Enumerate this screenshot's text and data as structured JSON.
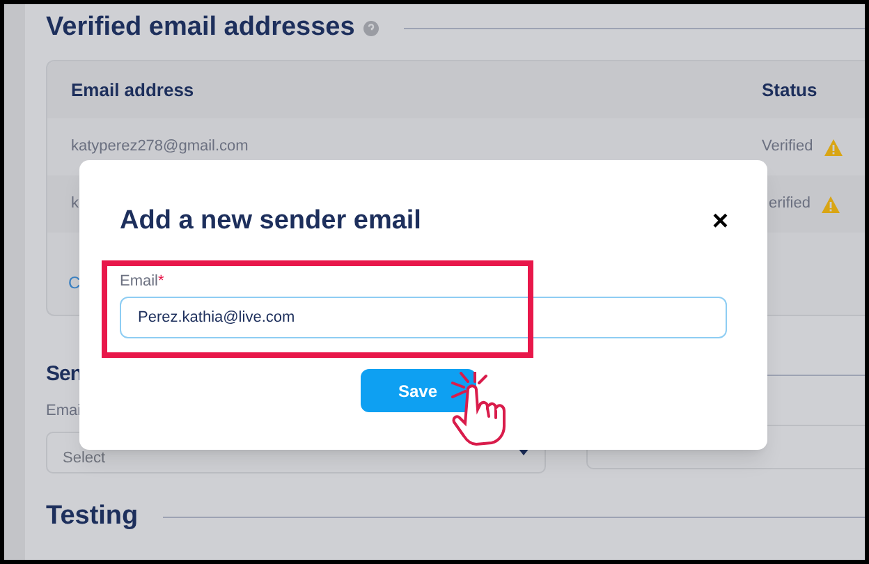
{
  "page": {
    "title": "Verified email addresses",
    "table": {
      "columns": [
        "Email address",
        "Status"
      ],
      "rows": [
        {
          "email": "katyperez278@gmail.com",
          "status": "Verified"
        },
        {
          "email": "k",
          "status": "erified"
        }
      ]
    },
    "link": "C",
    "sender_section": {
      "title": "Sen",
      "field_label": "Emai",
      "select_placeholder": "Select"
    },
    "testing_section": {
      "title": "Testing"
    }
  },
  "modal": {
    "title": "Add a new sender email",
    "close": "×",
    "field": {
      "label": "Email",
      "required_mark": "*",
      "value": "Perez.kathia@live.com"
    },
    "save_button": "Save"
  }
}
